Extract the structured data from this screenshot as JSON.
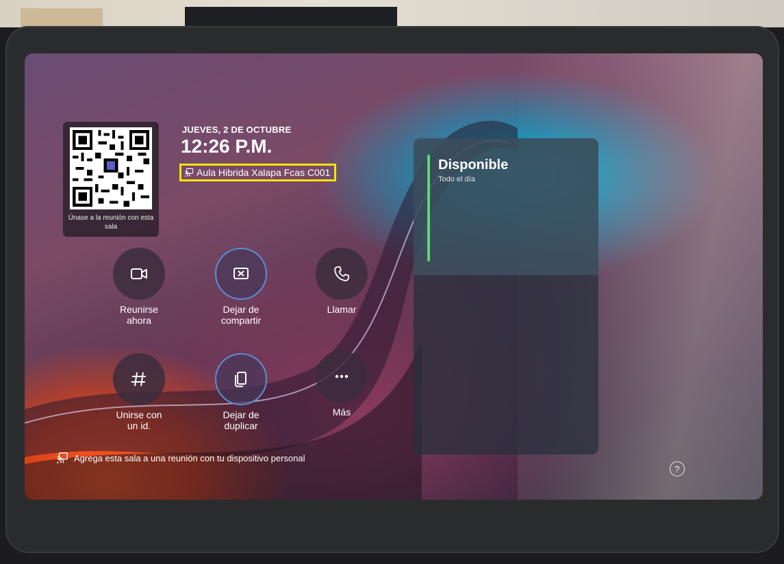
{
  "header": {
    "date": "JUEVES, 2 DE OCTUBRE",
    "time": "12:26 P.M.",
    "room_name": "Aula Hibrida Xalapa Fcas C001"
  },
  "qr": {
    "caption": "Únase a la reunión con esta sala"
  },
  "actions": [
    {
      "id": "meet-now",
      "label_line1": "Reunirse",
      "label_line2": "ahora",
      "icon": "video-camera-icon"
    },
    {
      "id": "stop-sharing",
      "label_line1": "Dejar de",
      "label_line2": "compartir",
      "icon": "stop-share-icon"
    },
    {
      "id": "call",
      "label_line1": "Llamar",
      "label_line2": "",
      "icon": "phone-icon"
    },
    {
      "id": "join-with-id",
      "label_line1": "Unirse con",
      "label_line2": "un id.",
      "icon": "hash-icon"
    },
    {
      "id": "stop-duplicating",
      "label_line1": "Dejar de",
      "label_line2": "duplicar",
      "icon": "copy-icon"
    },
    {
      "id": "more",
      "label_line1": "Más",
      "label_line2": "",
      "icon": "more-icon"
    }
  ],
  "hint": {
    "text": "Agrega esta sala a una reunión con tu dispositivo personal",
    "icon": "cast-icon"
  },
  "status": {
    "title": "Disponible",
    "subtitle": "Todo el día",
    "accent_color": "#5fd47a"
  },
  "help": {
    "glyph": "?"
  },
  "colors": {
    "highlight_border": "#f5e600",
    "outlined_button_border": "#5a8fd8"
  }
}
